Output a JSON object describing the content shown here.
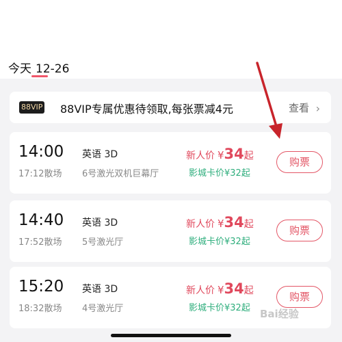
{
  "date_tab": {
    "day_label": "今天",
    "date": "12-26"
  },
  "promo": {
    "badge": "88VIP",
    "text": "88VIP专属优惠待领取,每张票减4元",
    "link_label": "查看",
    "chevron_icon": "chevron-right-icon"
  },
  "showtimes": [
    {
      "start": "14:00",
      "end": "17:12散场",
      "language": "英语 3D",
      "hall": "6号激光双机巨幕厅",
      "new_price_label": "新人价",
      "currency": "¥",
      "new_price": "34",
      "suffix": "起",
      "card_price": "影城卡价¥32起",
      "buy_label": "购票"
    },
    {
      "start": "14:40",
      "end": "17:52散场",
      "language": "英语 3D",
      "hall": "5号激光厅",
      "new_price_label": "新人价",
      "currency": "¥",
      "new_price": "34",
      "suffix": "起",
      "card_price": "影城卡价¥32起",
      "buy_label": "购票"
    },
    {
      "start": "15:20",
      "end": "18:32散场",
      "language": "英语 3D",
      "hall": "4号激光厅",
      "new_price_label": "新人价",
      "currency": "¥",
      "new_price": "34",
      "suffix": "起",
      "card_price": "影城卡价¥32起",
      "buy_label": "购票"
    }
  ],
  "watermark": "Bai经验",
  "colors": {
    "accent": "#e35565",
    "card_price": "#2fae7d",
    "annotation_arrow": "#c8242b"
  }
}
